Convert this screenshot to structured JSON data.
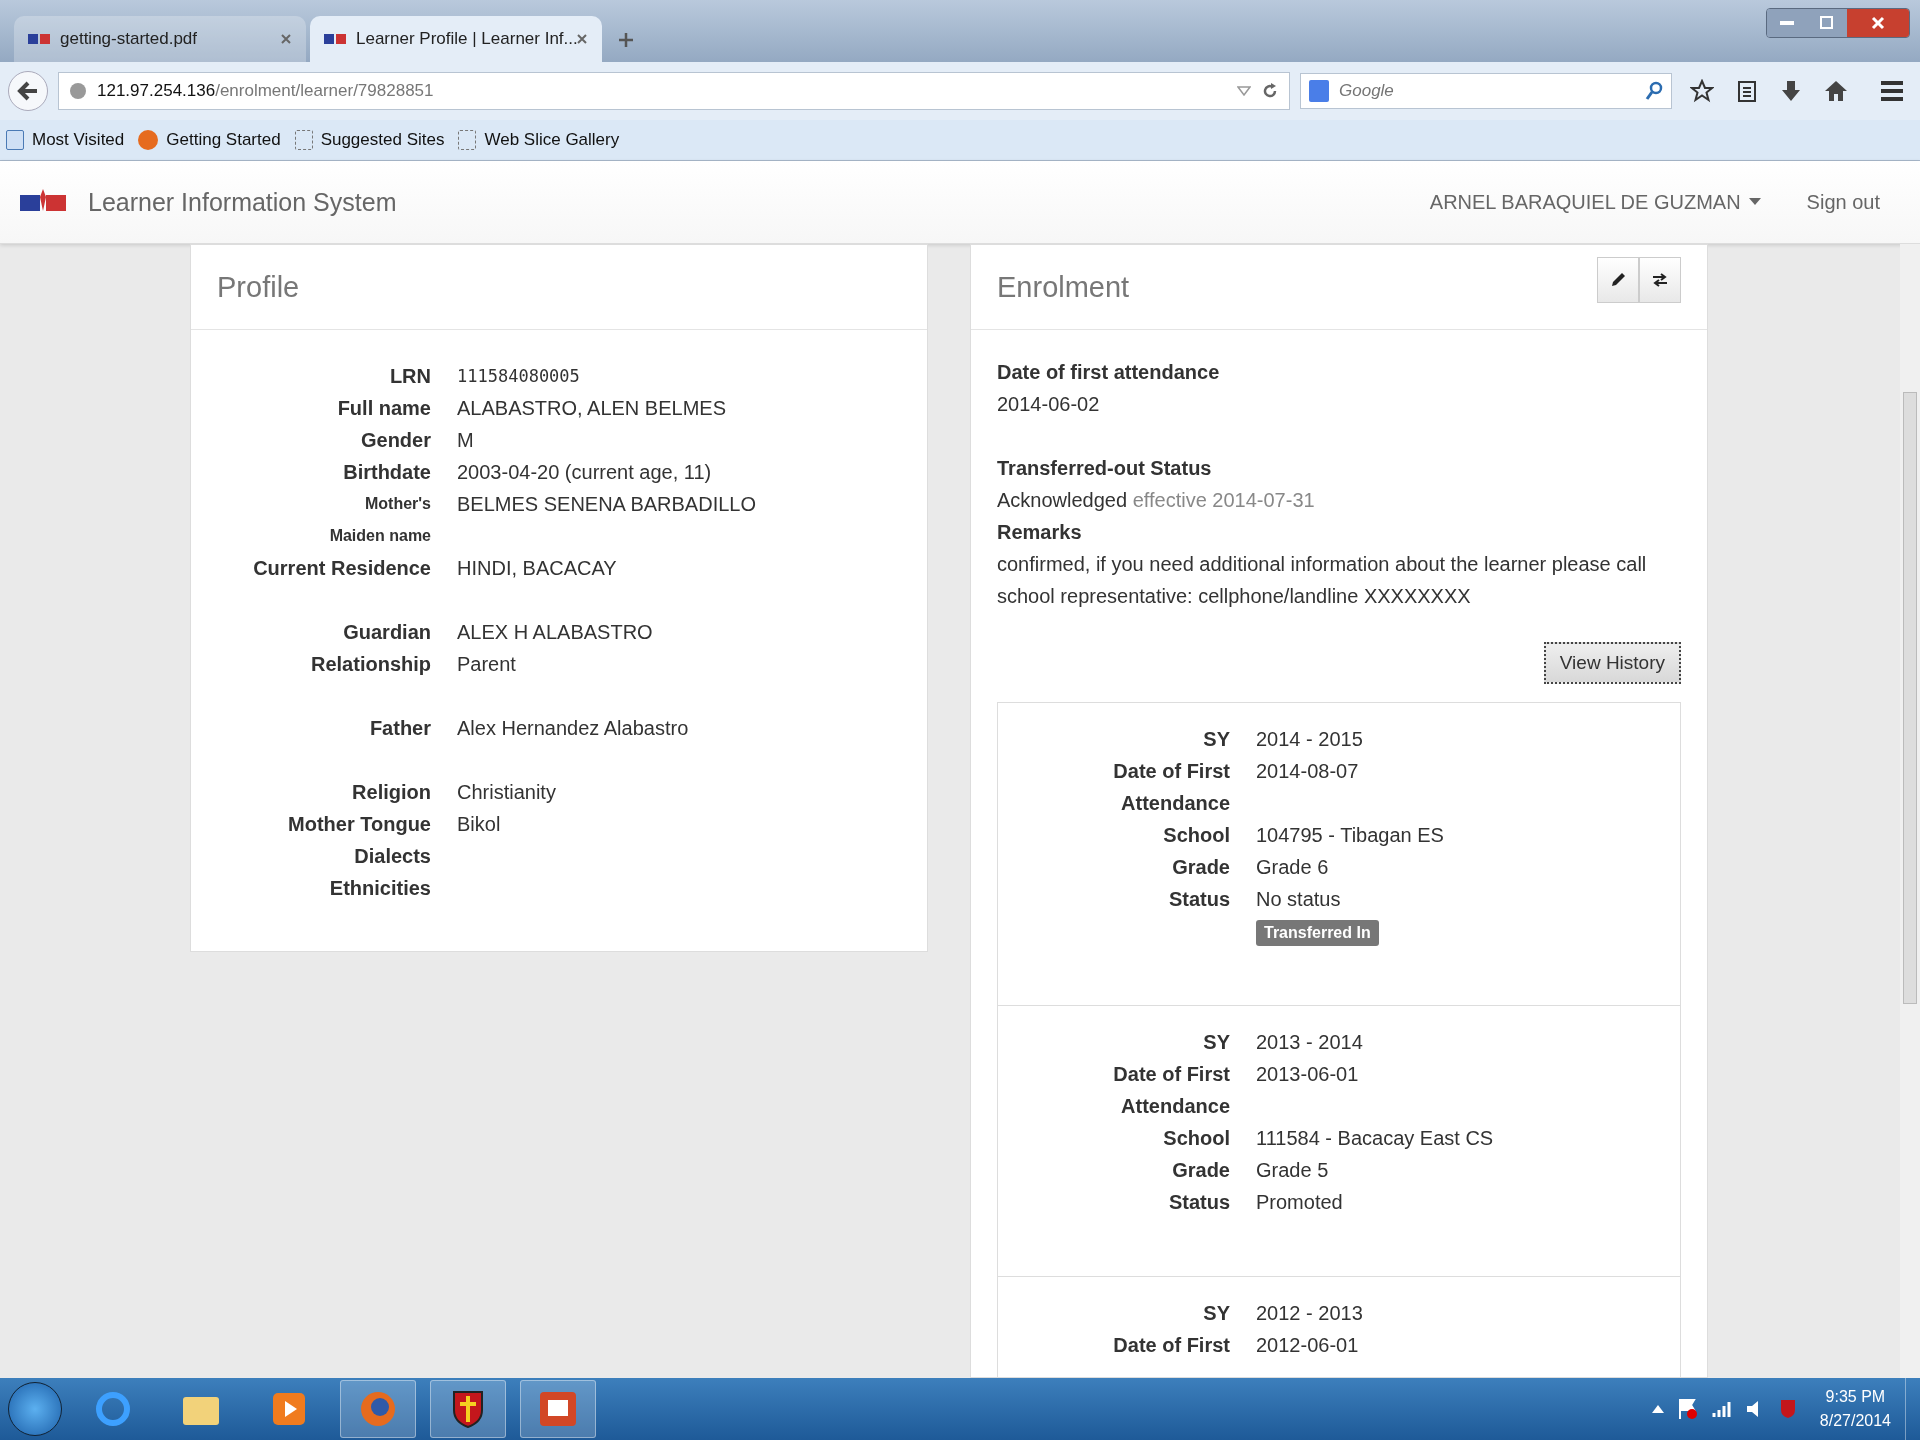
{
  "browser": {
    "tabs": [
      {
        "title": "getting-started.pdf",
        "selected": false
      },
      {
        "title": "Learner Profile | Learner Inf...",
        "selected": true
      }
    ],
    "url_host": "121.97.254.136",
    "url_path": "/enrolment/learner/79828851",
    "search": {
      "placeholder": "Google"
    },
    "bookmarks": [
      "Most Visited",
      "Getting Started",
      "Suggested Sites",
      "Web Slice Gallery"
    ]
  },
  "app": {
    "title": "Learner Information System",
    "user": "ARNEL BARAQUIEL DE GUZMAN",
    "signout": "Sign out"
  },
  "profile": {
    "title": "Profile",
    "groups": [
      [
        {
          "label": "LRN",
          "value": "111584080005",
          "kind": "mono"
        },
        {
          "label": "Full name",
          "value": "ALABASTRO, ALEN BELMES"
        },
        {
          "label": "Gender",
          "value": "M"
        },
        {
          "label": "Birthdate",
          "value": "2003-04-20 (current age, 11)"
        },
        {
          "label": "Mother's Maiden name",
          "value": "BELMES SENENA BARBADILLO",
          "kind": "small"
        },
        {
          "label": "Current Residence",
          "value": "HINDI, BACACAY"
        }
      ],
      [
        {
          "label": "Guardian",
          "value": "ALEX H ALABASTRO"
        },
        {
          "label": "Relationship",
          "value": "Parent"
        }
      ],
      [
        {
          "label": "Father",
          "value": "Alex Hernandez Alabastro"
        }
      ],
      [
        {
          "label": "Religion",
          "value": "Christianity"
        },
        {
          "label": "Mother Tongue",
          "value": "Bikol"
        },
        {
          "label": "Dialects"
        },
        {
          "label": "Ethnicities"
        }
      ]
    ]
  },
  "enrolment": {
    "title": "Enrolment",
    "first_attendance_label": "Date of first attendance",
    "first_attendance": "2014-06-02",
    "transfer_label": "Transferred-out Status",
    "transfer_status": "Acknowledged",
    "transfer_effective": "effective 2014-07-31",
    "remarks_label": "Remarks",
    "remarks": "confirmed, if you need additional information about the learner please call school representative: cellphone/landline XXXXXXXX",
    "history_button": "View History",
    "records": [
      {
        "fields": [
          {
            "label": "SY",
            "value": "2014 - 2015"
          },
          {
            "label": "Date of First Attendance",
            "value": "2014-08-07"
          },
          {
            "label": "School",
            "value": "104795 - Tibagan ES"
          },
          {
            "label": "Grade",
            "value": "Grade 6"
          },
          {
            "label": "Status",
            "value": "No status"
          }
        ],
        "badge": "Transferred In"
      },
      {
        "fields": [
          {
            "label": "SY",
            "value": "2013 - 2014"
          },
          {
            "label": "Date of First Attendance",
            "value": "2013-06-01"
          },
          {
            "label": "School",
            "value": "111584 - Bacacay East CS"
          },
          {
            "label": "Grade",
            "value": "Grade 5"
          },
          {
            "label": "Status",
            "value": "Promoted"
          }
        ]
      },
      {
        "fields": [
          {
            "label": "SY",
            "value": "2012 - 2013"
          },
          {
            "label": "Date of First",
            "value": "2012-06-01"
          }
        ]
      }
    ]
  },
  "taskbar": {
    "time": "9:35 PM",
    "date": "8/27/2014"
  }
}
